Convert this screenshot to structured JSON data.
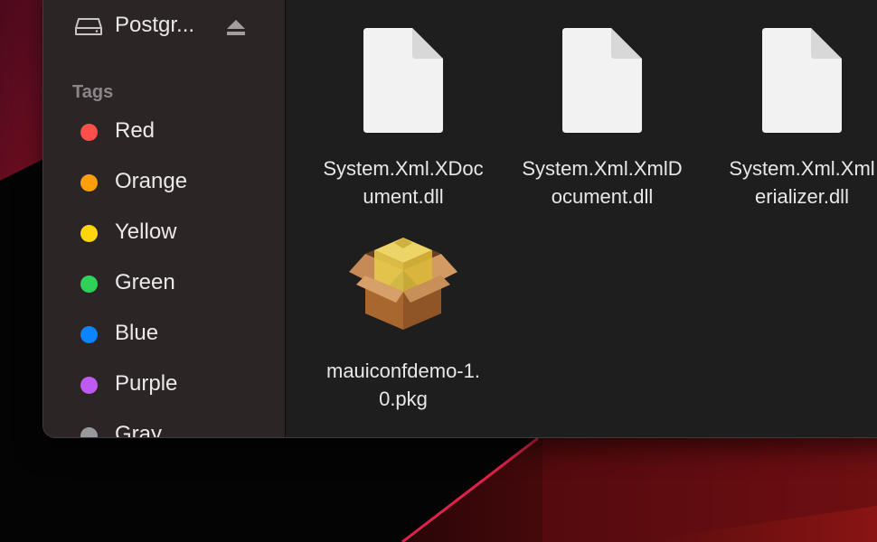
{
  "sidebar": {
    "volume": {
      "label": "Postgr...",
      "icon": "disk-icon",
      "eject_icon": "eject-icon"
    },
    "tags_title": "Tags",
    "tags": [
      {
        "label": "Red",
        "color": "#ff4f4a"
      },
      {
        "label": "Orange",
        "color": "#ff9f0a"
      },
      {
        "label": "Yellow",
        "color": "#ffd60a"
      },
      {
        "label": "Green",
        "color": "#30d158"
      },
      {
        "label": "Blue",
        "color": "#0a84ff"
      },
      {
        "label": "Purple",
        "color": "#bf5af2"
      },
      {
        "label": "Gray",
        "color": "#98989d"
      }
    ]
  },
  "files": [
    {
      "name": "System.Xml.XDoc\nument.dll",
      "icon": "document-icon"
    },
    {
      "name": "System.Xml.XmlD\nocument.dll",
      "icon": "document-icon"
    },
    {
      "name": "System.Xml.Xml\nerializer.dll",
      "icon": "document-icon"
    },
    {
      "name": "mauiconfdemo-1.\n0.pkg",
      "icon": "package-icon"
    }
  ]
}
